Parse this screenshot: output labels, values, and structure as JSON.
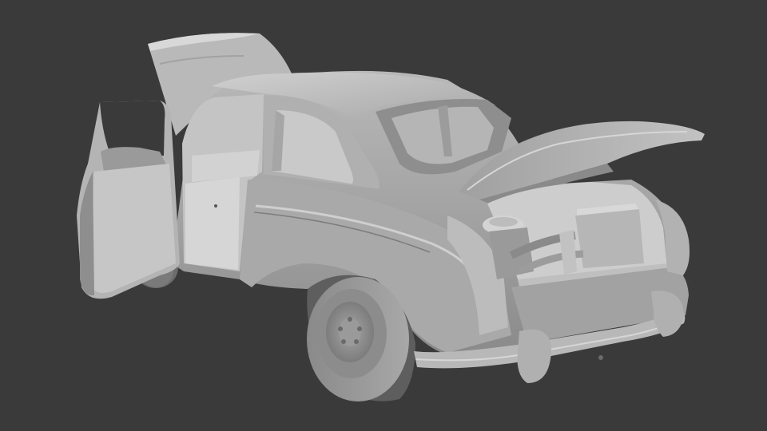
{
  "scene": {
    "background_color": "#3a3a3a",
    "model_base_color": "#9a9a9a",
    "model_highlight_color": "#c8c8c8",
    "model_shadow_color": "#6e6e6e",
    "model_dark_color": "#4c4c4c",
    "subject": "car-clay-render",
    "open_parts": [
      "front-left-door",
      "front-hood",
      "rear-engine-lid"
    ]
  }
}
